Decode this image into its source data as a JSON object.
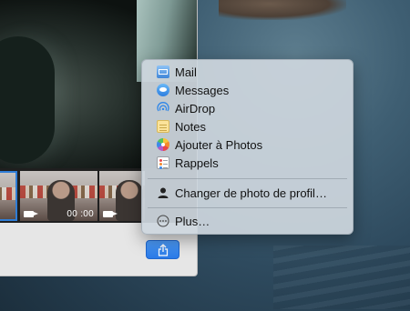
{
  "photo_booth": {
    "thumbnails": [
      {
        "type": "video",
        "duration": ""
      },
      {
        "type": "video",
        "duration": "00 :00"
      },
      {
        "type": "video",
        "duration": ""
      }
    ],
    "share_button_icon": "share-icon"
  },
  "share_menu": {
    "items": [
      {
        "label": "Mail",
        "icon": "mail-icon"
      },
      {
        "label": "Messages",
        "icon": "messages-icon"
      },
      {
        "label": "AirDrop",
        "icon": "airdrop-icon"
      },
      {
        "label": "Notes",
        "icon": "notes-icon"
      },
      {
        "label": "Ajouter à Photos",
        "icon": "photos-icon"
      },
      {
        "label": "Rappels",
        "icon": "reminders-icon"
      }
    ],
    "profile_item": {
      "label": "Changer de photo de profil…",
      "icon": "person-icon"
    },
    "more_item": {
      "label": "Plus…",
      "icon": "more-icon"
    }
  },
  "colors": {
    "accent": "#2a7ae8",
    "menu_bg": "#ced6de",
    "selection_border": "#2f7dd6"
  }
}
